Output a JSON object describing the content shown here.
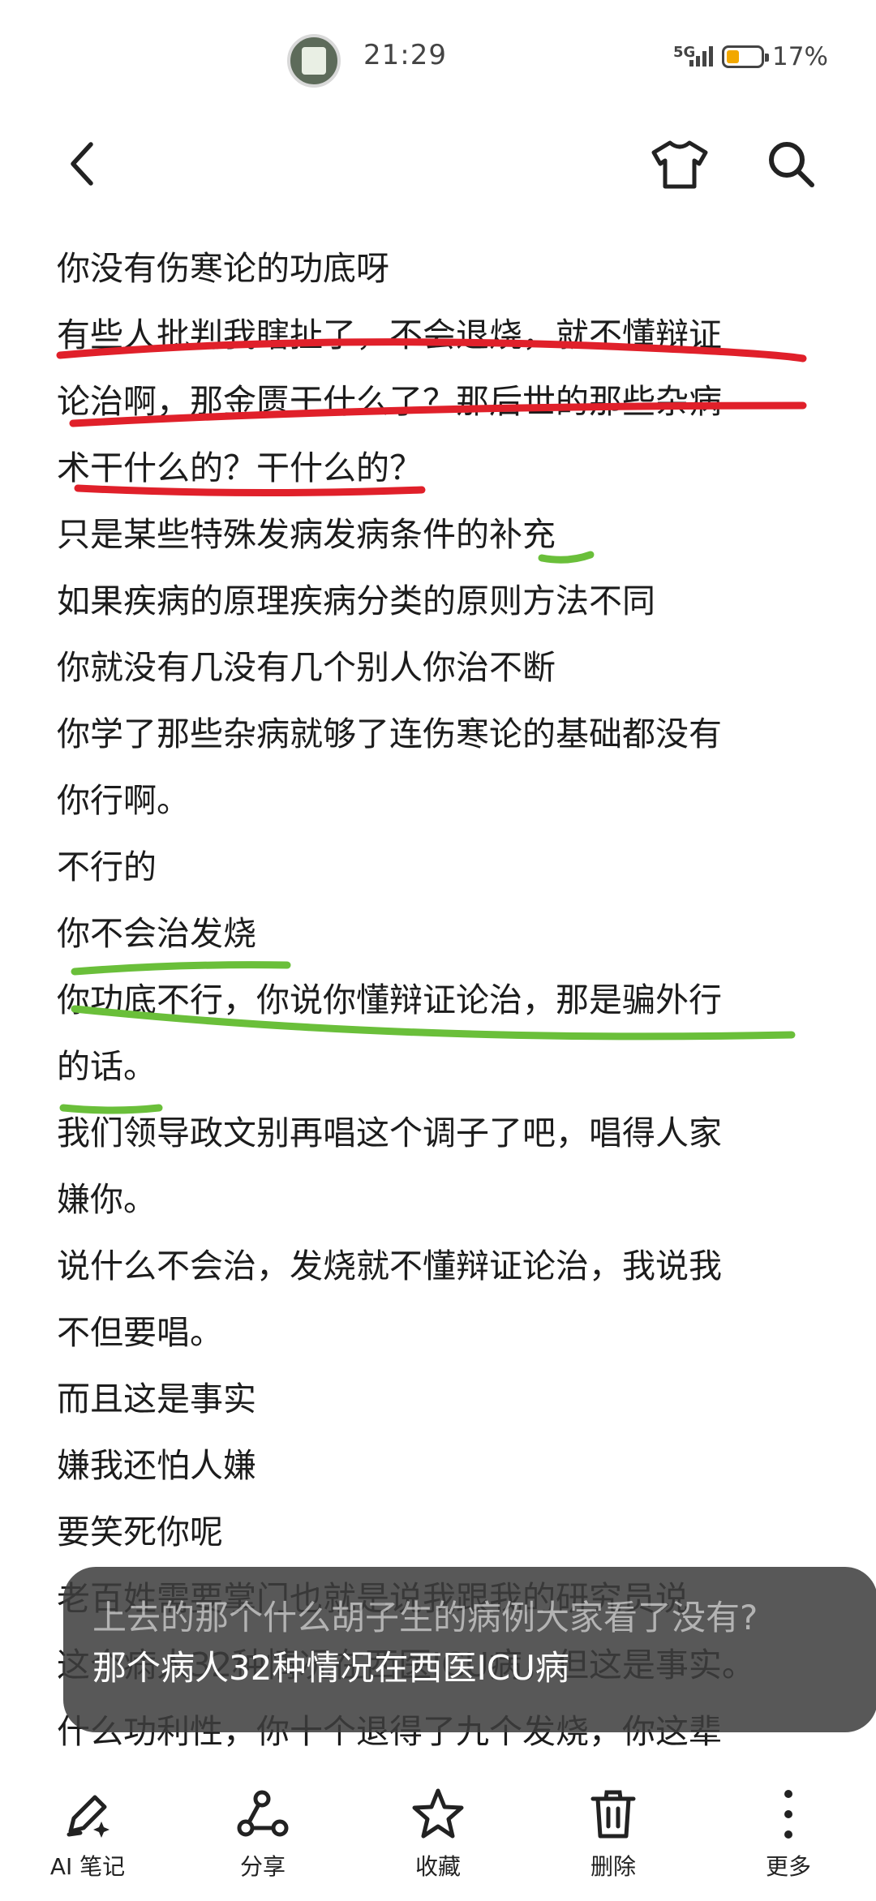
{
  "status_bar": {
    "time": "21:29",
    "network": "5G",
    "battery_percent": "17%",
    "battery_level": 0.17
  },
  "top_bar": {
    "back_icon": "chevron-left-icon",
    "shirt_icon": "tshirt-icon",
    "search_icon": "search-icon"
  },
  "content": {
    "lines": [
      "你没有伤寒论的功底呀",
      "有些人批判我瞎扯了，不会退烧，就不懂辩证",
      "论治啊，那金匮干什么了？那后世的那些杂病",
      "术干什么的？干什么的？",
      "只是某些特殊发病发病条件的补充",
      "如果疾病的原理疾病分类的原则方法不同",
      "你就没有几没有几个别人你治不断",
      "你学了那些杂病就够了连伤寒论的基础都没有",
      "你行啊。",
      "不行的",
      "你不会治发烧",
      "你功底不行，你说你懂辩证论治，那是骗外行",
      "的话。",
      "我们领导政文别再唱这个调子了吧，唱得人家",
      "嫌你。",
      "说什么不会治，发烧就不懂辩证论治，我说我",
      "不但要唱。",
      "而且这是事实",
      "嫌我还怕人嫌",
      "要笑死你呢",
      "老百姓需要掌门也就是说我跟我的研究员说",
      "这个病人32种情况在西医ICU病，但这是事实。",
      "什么功利性，你十个退得了九个发烧，你这辈"
    ],
    "red_mark_color": "#e0202a",
    "green_mark_color": "#6abf3a"
  },
  "toast": {
    "line1": "上去的那个什么胡子生的病例大家看了没有?",
    "line2": "那个病人32种情况在西医ICU病"
  },
  "bottom_bar": {
    "items": [
      {
        "label": "AI 笔记",
        "icon": "ai-pen-icon"
      },
      {
        "label": "分享",
        "icon": "share-icon"
      },
      {
        "label": "收藏",
        "icon": "star-icon"
      },
      {
        "label": "删除",
        "icon": "trash-icon"
      },
      {
        "label": "更多",
        "icon": "more-vertical-icon"
      }
    ]
  }
}
